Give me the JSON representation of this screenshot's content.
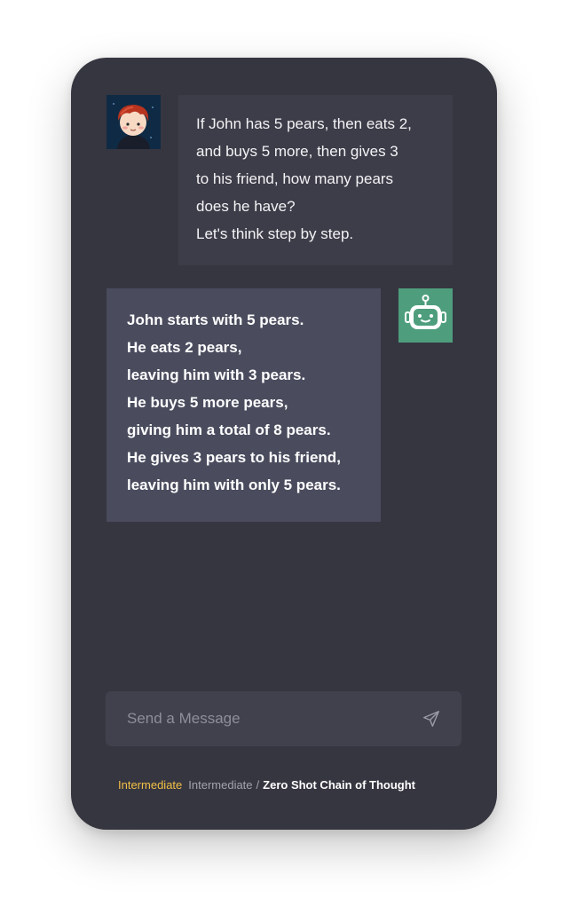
{
  "conversation": {
    "user_message": {
      "lines": [
        "If John has 5 pears, then eats 2,",
        "and buys 5 more, then gives 3",
        "to his friend, how many pears",
        "does he have?",
        "Let's think step by step."
      ],
      "avatar_icon": "boy-avatar-icon"
    },
    "bot_message": {
      "lines": [
        "John starts with 5 pears.",
        "He eats 2 pears,",
        "leaving him with 3 pears.",
        "He buys 5 more pears,",
        "giving him a total of 8 pears.",
        "He gives 3 pears to his friend,",
        "leaving him with only 5 pears."
      ],
      "avatar_icon": "robot-icon"
    }
  },
  "composer": {
    "placeholder": "Send a Message",
    "value": "",
    "send_icon": "send-icon"
  },
  "breadcrumb": {
    "level_badge": "Intermediate",
    "category": "Intermediate",
    "separator": "/",
    "current": "Zero Shot Chain of Thought"
  },
  "colors": {
    "panel_background": "#363641",
    "user_bubble": "#3d3d49",
    "bot_bubble": "#4a4c5e",
    "bot_avatar": "#4e9e7d",
    "level_badge": "#f2c046"
  }
}
